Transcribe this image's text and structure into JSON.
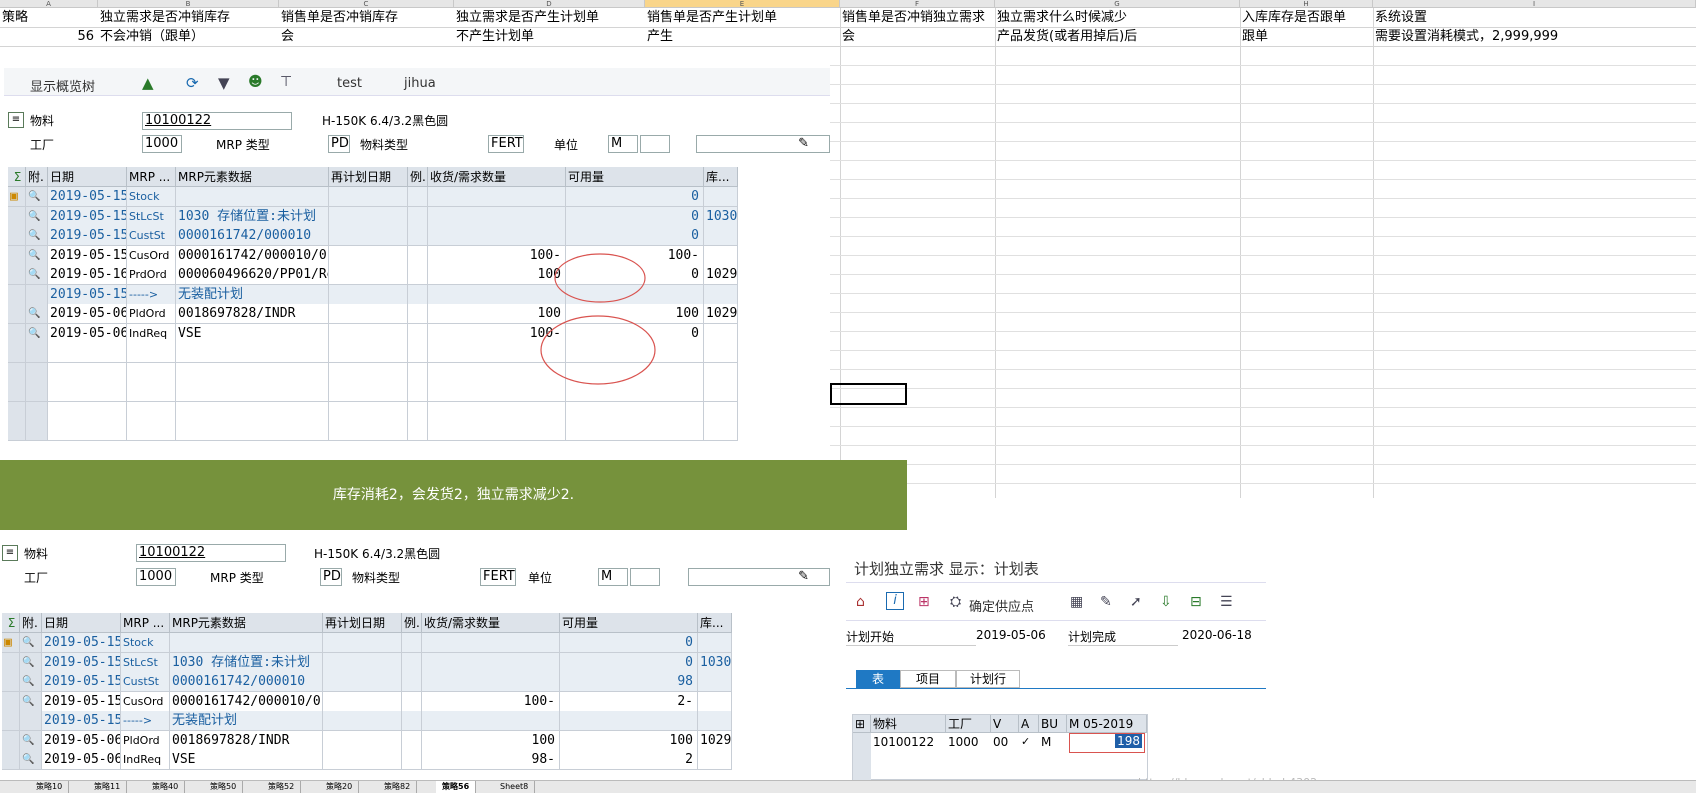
{
  "excel": {
    "columns": [
      "A",
      "B",
      "C",
      "D",
      "E",
      "F",
      "G",
      "H",
      "I"
    ],
    "header_row": [
      "策略",
      "独立需求是否冲销库存",
      "销售单是否冲销库存",
      "独立需求是否产生计划单",
      "销售单是否产生计划单",
      "销售单是否冲销独立需求",
      "独立需求什么时候减少",
      "入库库存是否跟单",
      "系统设置"
    ],
    "value_row": [
      "56",
      "不会冲销（跟单）",
      "会",
      "不产生计划单",
      "产生",
      "会",
      "产品发货(或者用掉后)后",
      "跟单",
      "需要设置消耗模式，2,999,999"
    ],
    "sheet_tabs": [
      "策略10",
      "策略11",
      "策略40",
      "策略50",
      "策略52",
      "策略20",
      "策略82",
      "策略56",
      "Sheet8"
    ]
  },
  "banner": {
    "text": "库存消耗2，会发货2，独立需求减少2.",
    "color": "#76923c"
  },
  "sap_top": {
    "toolbar": {
      "overview_tree": "显示概览树",
      "test": "test",
      "jihua": "jihua"
    },
    "material_label": "物料",
    "material_value": "10100122",
    "material_desc": "H-150K 6.4/3.2黑色圆",
    "plant_label": "工厂",
    "plant_value": "1000",
    "mrp_type_label": "MRP 类型",
    "mrp_type_value": "PD",
    "mat_type_label": "物料类型",
    "mat_type_value": "FERT",
    "unit_label": "单位",
    "unit_value": "M",
    "columns": [
      "附.",
      "日期",
      "MRP ...",
      "MRP元素数据",
      "再计划日期",
      "例.",
      "收货/需求数量",
      "可用量",
      "库..."
    ],
    "rows": [
      {
        "date": "2019-05-15",
        "mrp": "Stock",
        "data": "",
        "qty": "",
        "avail": "0",
        "stor": "",
        "blue": true
      },
      {
        "date": "2019-05-15",
        "mrp": "StLcSt",
        "data": "1030 存储位置:未计划",
        "qty": "",
        "avail": "0",
        "stor": "1030",
        "blue": true
      },
      {
        "date": "2019-05-15",
        "mrp": "CustSt",
        "data": "0000161742/000010",
        "qty": "",
        "avail": "0",
        "stor": "",
        "blue": true
      },
      {
        "date": "2019-05-15",
        "mrp": "CusOrd",
        "data": "0000161742/000010/0...",
        "qty": "100-",
        "avail": "100-",
        "stor": "",
        "blue": false
      },
      {
        "date": "2019-05-16",
        "mrp": "PrdOrd",
        "data": "000060496620/PP01/Re",
        "qty": "100",
        "avail": "0",
        "stor": "1029",
        "blue": false
      },
      {
        "date": "2019-05-15",
        "mrp": "----->",
        "data": "无装配计划",
        "qty": "",
        "avail": "",
        "stor": "",
        "blue": true
      },
      {
        "date": "2019-05-06",
        "mrp": "PldOrd",
        "data": "0018697828/INDR",
        "qty": "100",
        "avail": "100",
        "stor": "1029",
        "blue": false
      },
      {
        "date": "2019-05-06",
        "mrp": "IndReq",
        "data": "VSE",
        "qty": "100-",
        "avail": "0",
        "stor": "",
        "blue": false
      }
    ]
  },
  "sap_bottom": {
    "material_label": "物料",
    "material_value": "10100122",
    "material_desc": "H-150K 6.4/3.2黑色圆",
    "plant_label": "工厂",
    "plant_value": "1000",
    "mrp_type_label": "MRP 类型",
    "mrp_type_value": "PD",
    "mat_type_label": "物料类型",
    "mat_type_value": "FERT",
    "unit_label": "单位",
    "unit_value": "M",
    "columns": [
      "附.",
      "日期",
      "MRP ...",
      "MRP元素数据",
      "再计划日期",
      "例.",
      "收货/需求数量",
      "可用量",
      "库..."
    ],
    "rows": [
      {
        "date": "2019-05-15",
        "mrp": "Stock",
        "data": "",
        "qty": "",
        "avail": "0",
        "stor": "",
        "blue": true
      },
      {
        "date": "2019-05-15",
        "mrp": "StLcSt",
        "data": "1030 存储位置:未计划",
        "qty": "",
        "avail": "0",
        "stor": "1030",
        "blue": true
      },
      {
        "date": "2019-05-15",
        "mrp": "CustSt",
        "data": "0000161742/000010",
        "qty": "",
        "avail": "98",
        "stor": "",
        "blue": true
      },
      {
        "date": "2019-05-15",
        "mrp": "CusOrd",
        "data": "0000161742/000010/0...",
        "qty": "100-",
        "avail": "2-",
        "stor": "",
        "blue": false
      },
      {
        "date": "2019-05-15",
        "mrp": "----->",
        "data": "无装配计划",
        "qty": "",
        "avail": "",
        "stor": "",
        "blue": true
      },
      {
        "date": "2019-05-06",
        "mrp": "PldOrd",
        "data": "0018697828/INDR",
        "qty": "100",
        "avail": "100",
        "stor": "1029",
        "blue": false
      },
      {
        "date": "2019-05-06",
        "mrp": "IndReq",
        "data": "VSE",
        "qty": "98-",
        "avail": "2",
        "stor": "",
        "blue": false
      }
    ]
  },
  "pir": {
    "title": "计划独立需求 显示：计划表",
    "confirm_supply": "确定供应点",
    "plan_start_label": "计划开始",
    "plan_start": "2019-05-06",
    "plan_end_label": "计划完成",
    "plan_end": "2020-06-18",
    "tabs": [
      "表",
      "项目",
      "计划行"
    ],
    "columns": [
      "物料",
      "工厂",
      "V",
      "A",
      "BU",
      "M 05-2019"
    ],
    "row": {
      "material": "10100122",
      "plant": "1000",
      "v": "00",
      "a": "✓",
      "bu": "M",
      "qty": "198"
    }
  },
  "watermark": "https://blog.csdn.net/chbyb4302"
}
